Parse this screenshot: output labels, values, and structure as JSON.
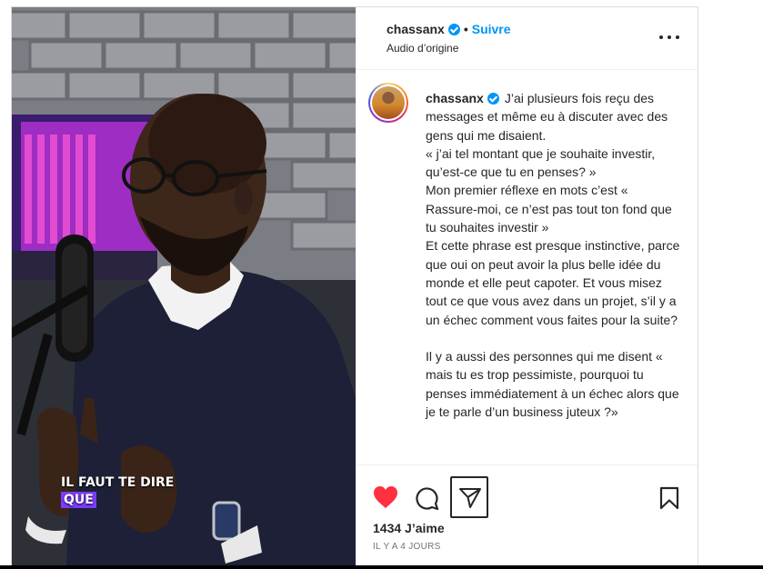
{
  "post": {
    "username": "chassanx",
    "follow_label": "Suivre",
    "separator": "•",
    "audio": "Audio d’origine",
    "caption_text": "J’ai plusieurs fois reçu des messages et même eu à discuter avec des gens qui me disaient.\n« j’ai tel montant que je souhaite investir, qu’est-ce que tu en penses? »\nMon premier réflexe en mots c’est « Rassure-moi, ce n’est pas tout ton fond que tu souhaites investir »\nEt cette phrase est presque instinctive, parce que oui on peut avoir la plus belle idée du monde et elle peut capoter. Et vous misez tout ce que vous avez dans un projet, s’il y a un échec comment vous faites pour la suite?\n\nIl y a aussi des personnes qui me disent « mais tu es trop pessimiste, pourquoi tu penses immédiatement à un échec alors que je te parle d’un business juteux ?»",
    "likes": "1434 J’aime",
    "time": "IL Y A 4 JOURS"
  },
  "video_overlay": {
    "line1": "IL FAUT TE DIRE",
    "line2": "QUE"
  },
  "icons": {
    "like": "heart-filled-icon",
    "comment": "comment-icon",
    "share": "paper-plane-icon",
    "save": "bookmark-icon",
    "more": "more-horizontal-icon",
    "verified": "verified-badge-icon"
  },
  "colors": {
    "accent": "#0095f6",
    "like": "#ff3040",
    "overlay_highlight": "#7b3cff"
  }
}
